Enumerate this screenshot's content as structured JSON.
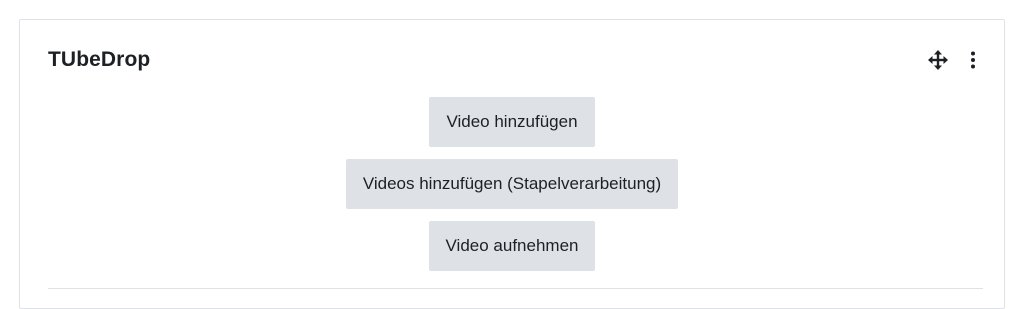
{
  "block": {
    "title": "TUbeDrop",
    "move_icon": "move-arrows-icon",
    "menu_icon": "vertical-dots-icon"
  },
  "actions": {
    "add_video": "Video hinzufügen",
    "add_videos_batch": "Videos hinzufügen (Stapelverarbeitung)",
    "record_video": "Video aufnehmen"
  },
  "colors": {
    "button_bg": "#dee2e6",
    "border": "#dee2e6",
    "text": "#1d2125"
  }
}
